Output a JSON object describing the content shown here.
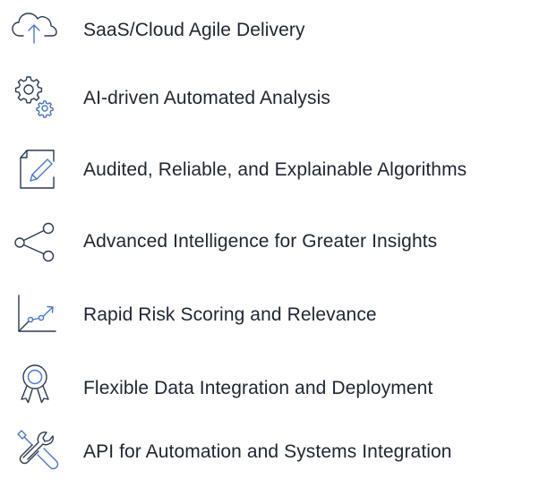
{
  "theme": {
    "icon_color": "#4a76c9",
    "icon_outline_color": "#2b3a52",
    "text_color": "#1f2633",
    "background": "#ffffff"
  },
  "features": [
    {
      "icon": "cloud-upload-icon",
      "label": "SaaS/Cloud Agile Delivery"
    },
    {
      "icon": "gears-icon",
      "label": "AI-driven Automated Analysis"
    },
    {
      "icon": "document-edit-icon",
      "label": "Audited, Reliable, and Explainable Algorithms"
    },
    {
      "icon": "share-nodes-icon",
      "label": "Advanced Intelligence for Greater Insights"
    },
    {
      "icon": "trend-chart-icon",
      "label": "Rapid Risk Scoring and Relevance"
    },
    {
      "icon": "award-ribbon-icon",
      "label": "Flexible Data Integration and Deployment"
    },
    {
      "icon": "tools-wrench-icon",
      "label": "API for Automation and Systems Integration"
    }
  ]
}
